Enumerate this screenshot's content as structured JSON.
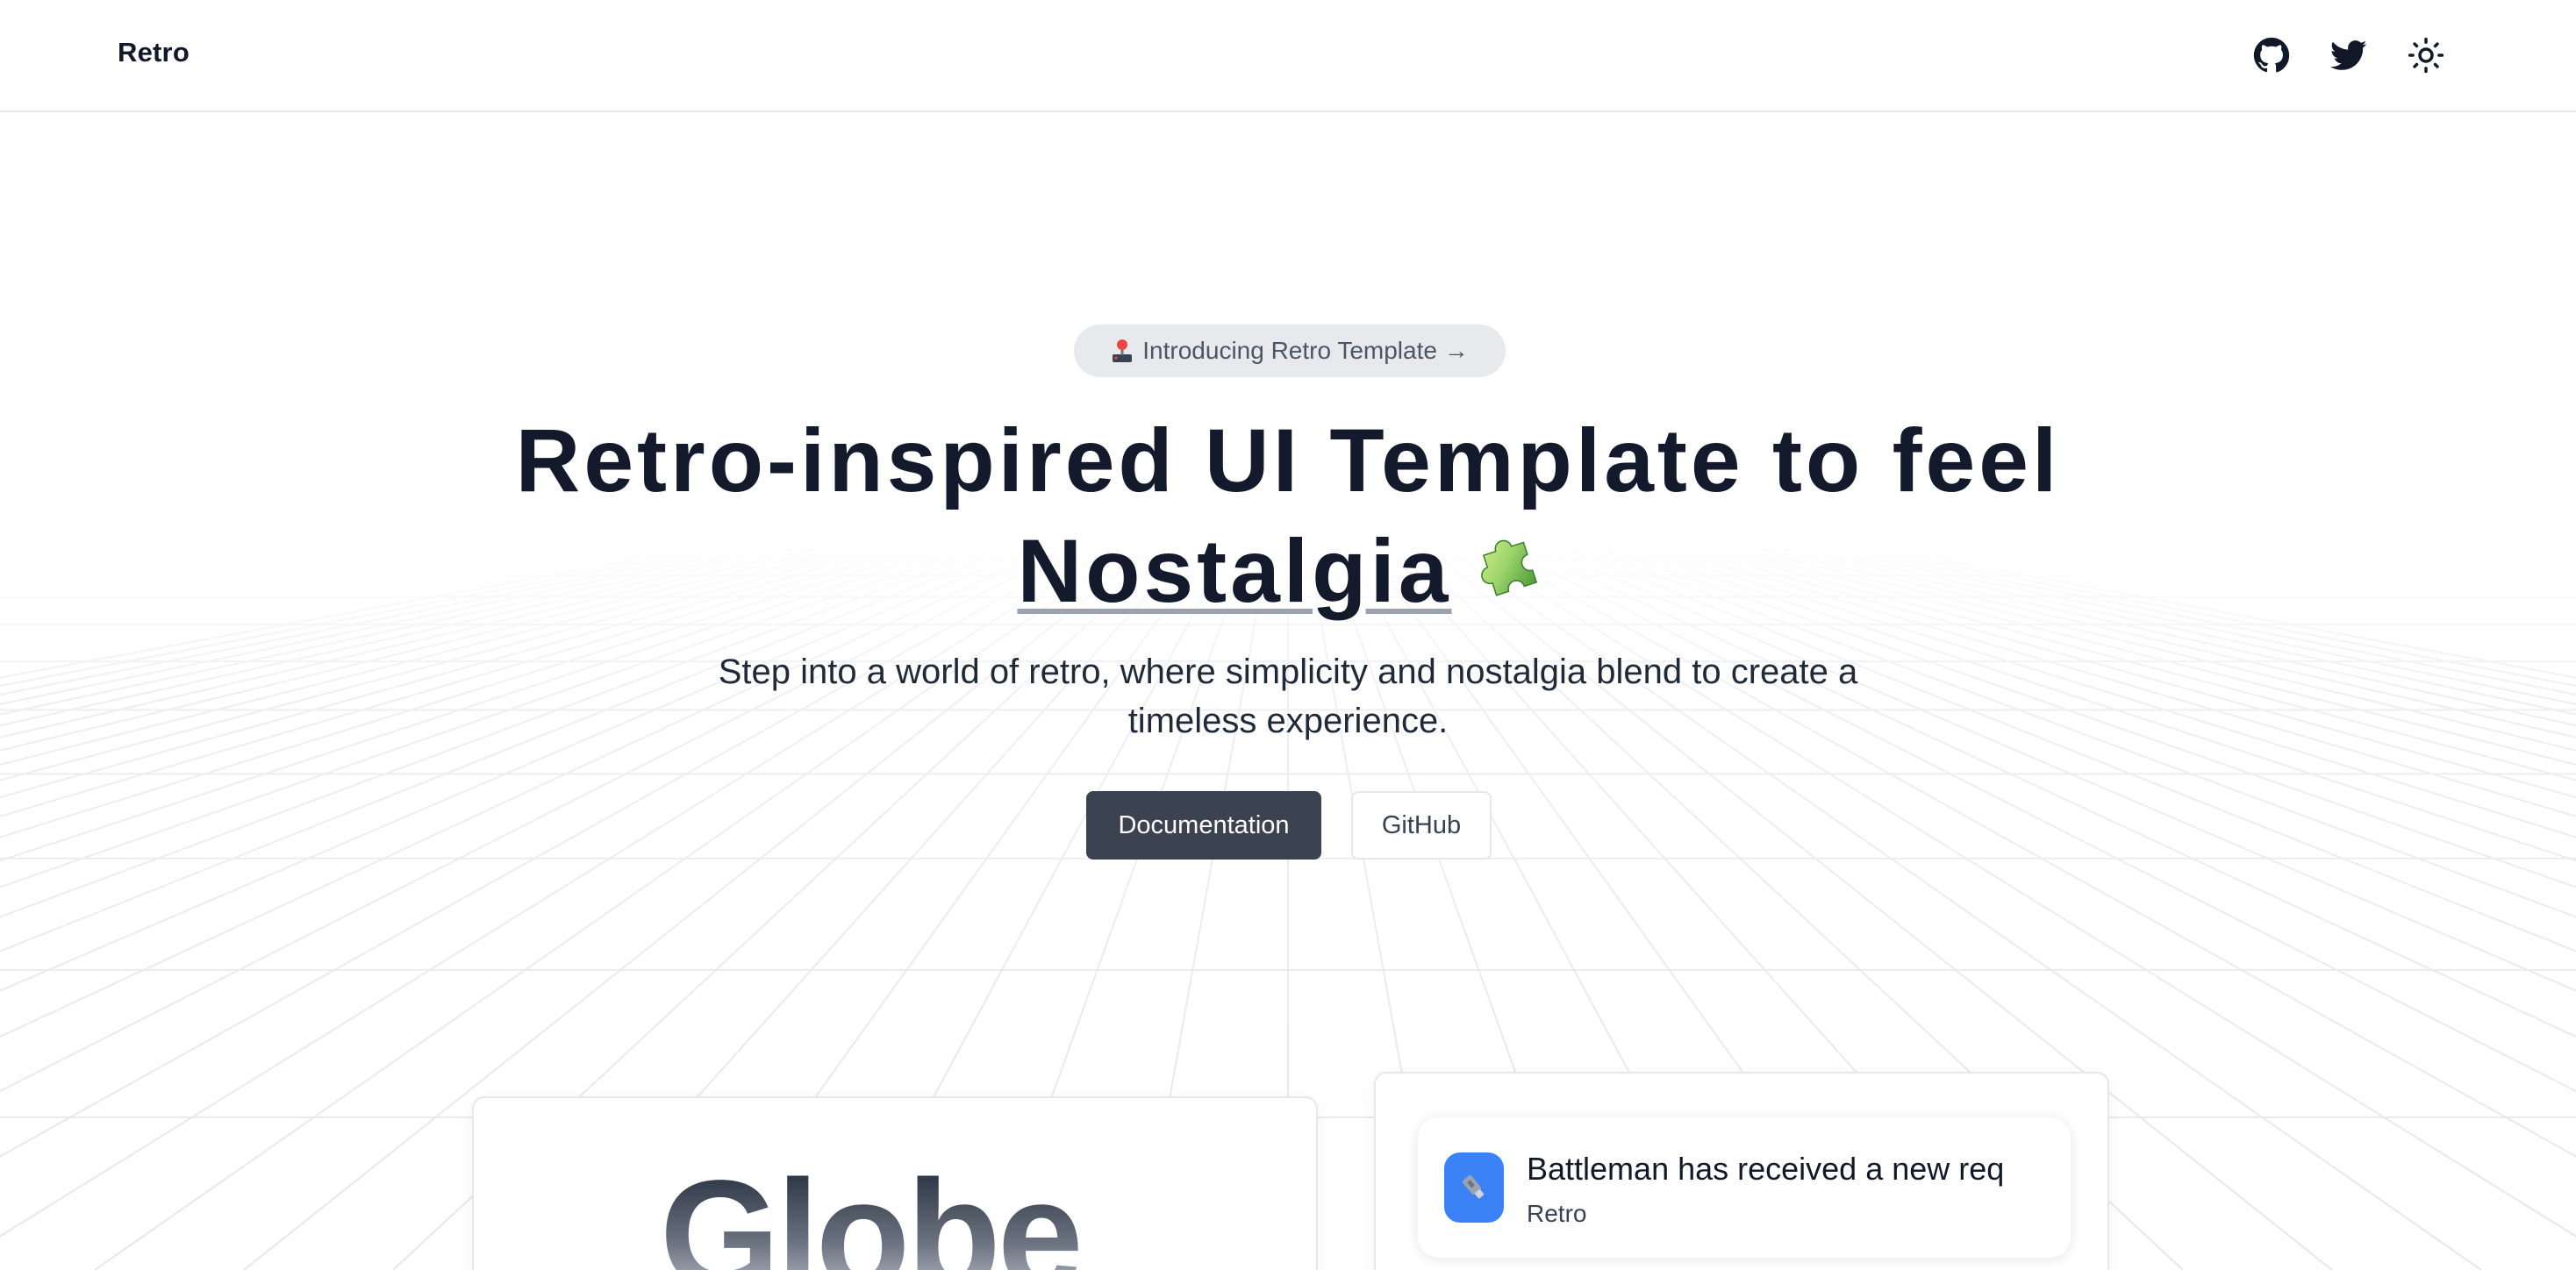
{
  "header": {
    "brand": "Retro",
    "icons": [
      "github-icon",
      "twitter-icon",
      "sun-icon"
    ]
  },
  "hero": {
    "pill_text": "Introducing Retro Template →",
    "headline_line1": "Retro-inspired UI Template to feel",
    "headline_word": "Nostalgia",
    "subtitle_line1": "Step into a world of retro, where simplicity and nostalgia blend to create a",
    "subtitle_line2": "timeless experience.",
    "primary_button": "Documentation",
    "secondary_button": "GitHub"
  },
  "cards": {
    "globe_title": "Globe",
    "notification_title": "Battleman has received a new req",
    "notification_subtitle": "Retro"
  },
  "colors": {
    "primary_button_bg": "#3c4350",
    "headline": "#131a2b",
    "avatar_bg": "#3b82f6",
    "pill_bg": "#e8e9ec"
  }
}
